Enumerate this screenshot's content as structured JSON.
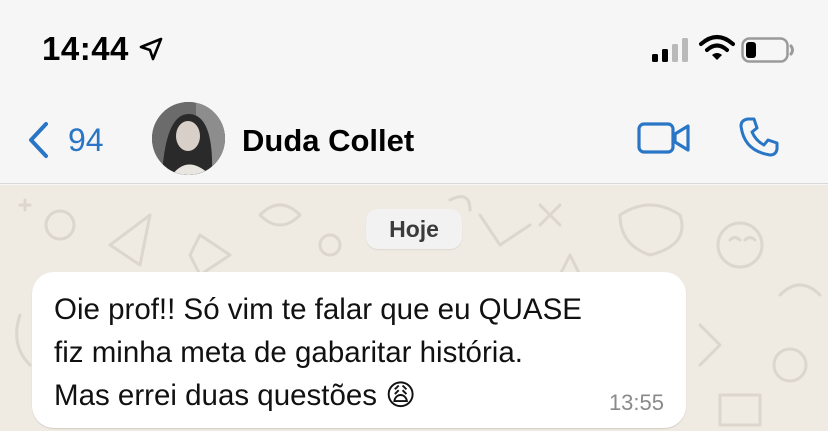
{
  "status_bar": {
    "time": "14:44",
    "icons": [
      "location-arrow-icon",
      "cellular-signal-icon",
      "wifi-icon",
      "battery-icon"
    ],
    "battery_level": 0.25
  },
  "header": {
    "back_count": "94",
    "contact_name": "Duda Collet",
    "icons": [
      "chevron-left-icon",
      "video-call-icon",
      "phone-icon"
    ],
    "accent_color": "#2a76c6"
  },
  "chat": {
    "date_label": "Hoje",
    "messages": [
      {
        "lines": [
          "Oie prof!! Só vim te falar que eu QUASE",
          "fiz minha meta de gabaritar história.",
          "Mas errei duas questões 😩"
        ],
        "time": "13:55"
      }
    ]
  }
}
